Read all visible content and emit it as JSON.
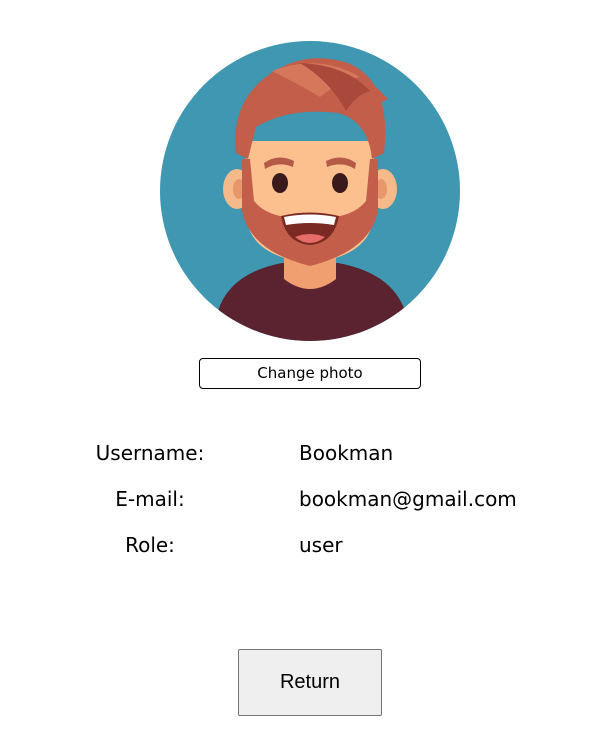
{
  "avatar": {
    "icon": "cartoon-bearded-man-avatar",
    "background_color": "#3f97b1"
  },
  "change_photo_label": "Change photo",
  "profile": {
    "rows": [
      {
        "label": "Username:",
        "value": "Bookman"
      },
      {
        "label": "E-mail:",
        "value": "bookman@gmail.com"
      },
      {
        "label": "Role:",
        "value": "user"
      }
    ]
  },
  "return_label": "Return"
}
